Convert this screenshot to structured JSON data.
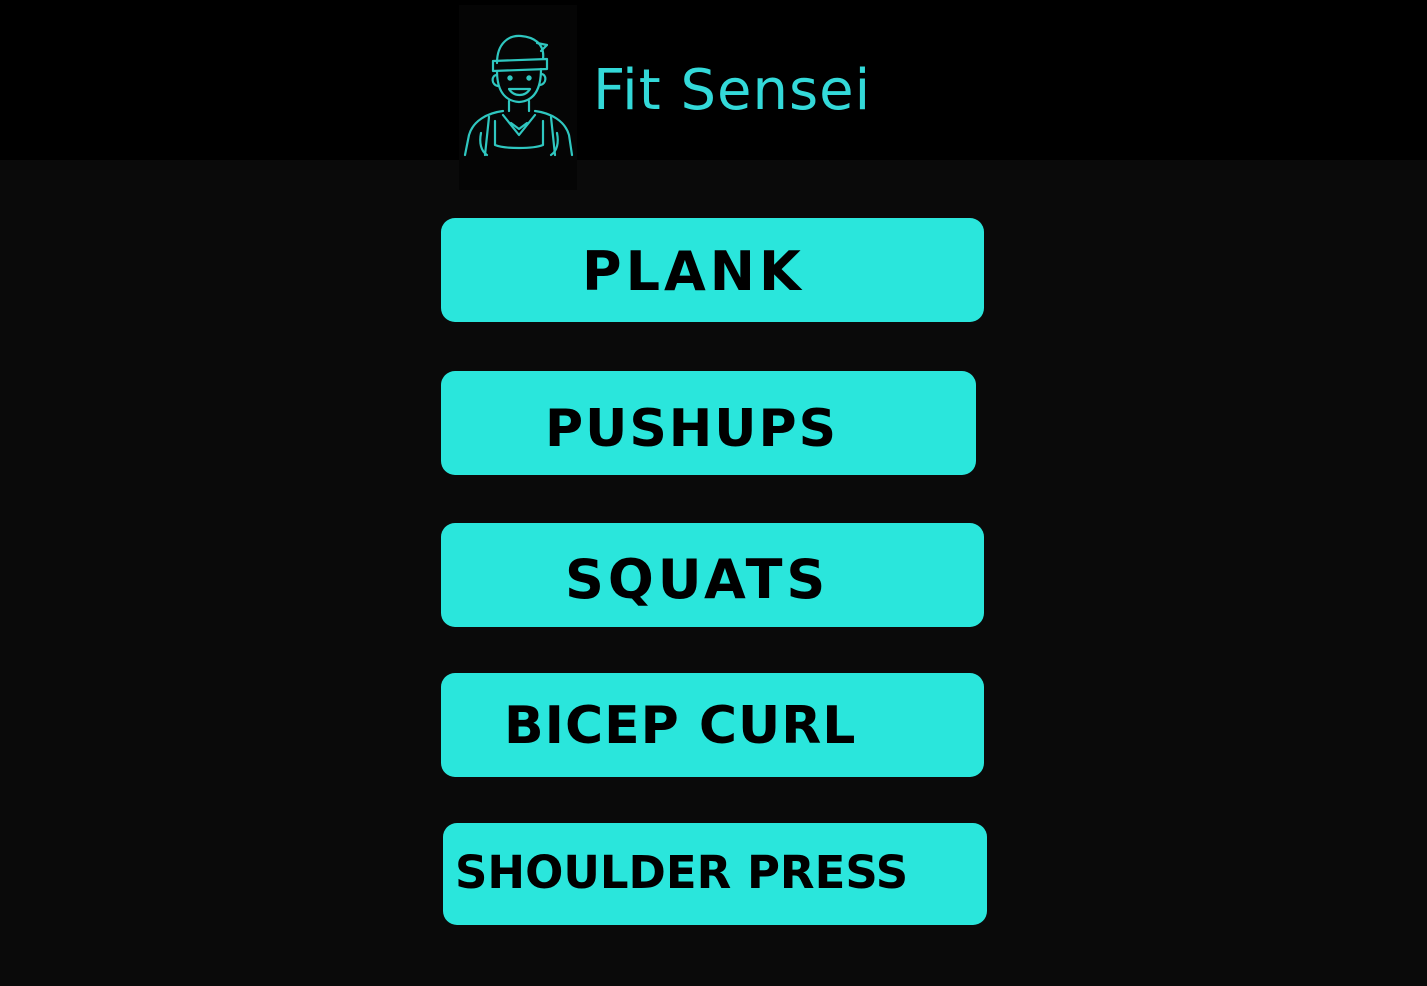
{
  "app": {
    "title": "Fit Sensei",
    "logo_icon": "ninja-trainer-icon"
  },
  "colors": {
    "accent": "#2ae6dc",
    "brand_text": "#33d9d9",
    "header_bg": "#000000",
    "page_bg": "#0a0a0a",
    "button_text": "#000000"
  },
  "exercises": [
    {
      "label": "PLANK"
    },
    {
      "label": "PUSHUPS"
    },
    {
      "label": "SQUATS"
    },
    {
      "label": "BICEP CURL"
    },
    {
      "label": "SHOULDER PRESS"
    }
  ]
}
